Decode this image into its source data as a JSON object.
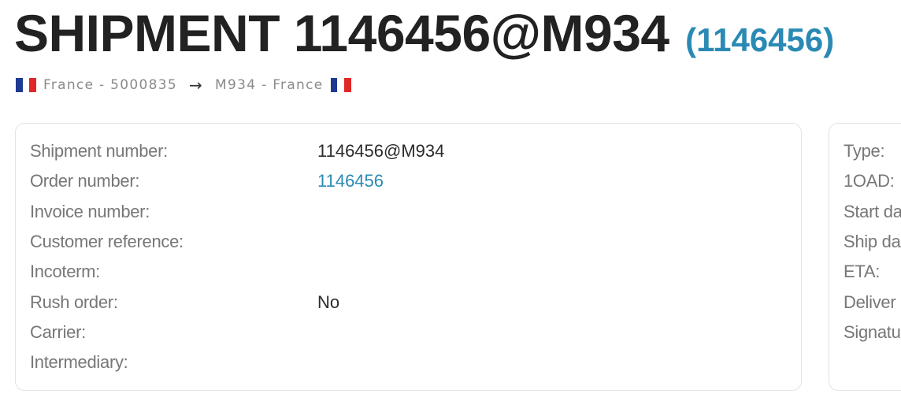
{
  "header": {
    "title": "SHIPMENT 1146456@M934",
    "order_ref": "(1146456)"
  },
  "route": {
    "origin_flag": "flag-france",
    "origin": "France - 5000835",
    "arrow": "→",
    "destination": "M934 - France",
    "destination_flag": "flag-france"
  },
  "details": {
    "fields": [
      {
        "label": "Shipment number:",
        "value": "1146456@M934"
      },
      {
        "label": "Order number:",
        "value": "1146456"
      },
      {
        "label": "Invoice number:",
        "value": ""
      },
      {
        "label": "Customer reference:",
        "value": ""
      },
      {
        "label": "Incoterm:",
        "value": ""
      },
      {
        "label": "Rush order:",
        "value": "No"
      },
      {
        "label": "Carrier:",
        "value": ""
      },
      {
        "label": "Intermediary:",
        "value": ""
      }
    ]
  },
  "dates": {
    "labels": [
      "Type:",
      "1OAD:",
      "Start da",
      "Ship da",
      "ETA:",
      "Deliver",
      "Signatu"
    ]
  },
  "colors": {
    "link": "#2a8ab4",
    "label": "#777777",
    "title": "#222222"
  }
}
